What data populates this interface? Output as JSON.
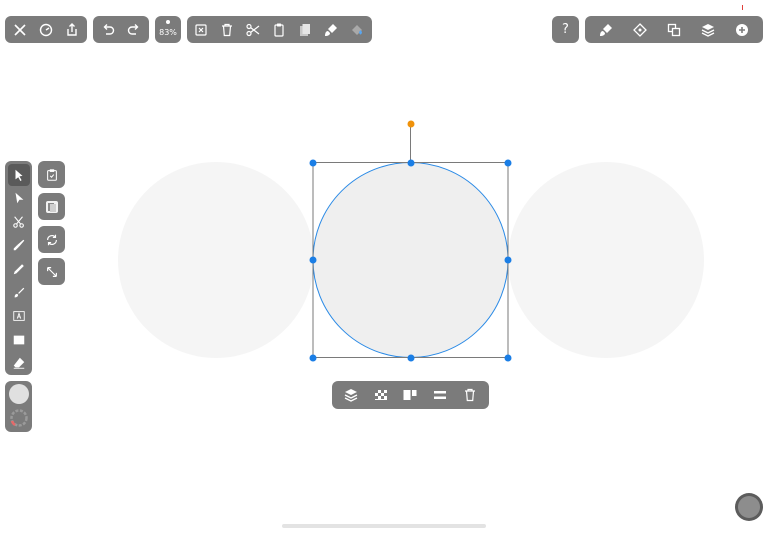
{
  "top_left": {
    "buttons": [
      {
        "name": "close-button",
        "icon": "close-icon"
      },
      {
        "name": "gallery-button",
        "icon": "gallery-icon"
      },
      {
        "name": "share-button",
        "icon": "share-icon"
      }
    ]
  },
  "history": {
    "buttons": [
      {
        "name": "undo-button",
        "icon": "undo-icon"
      },
      {
        "name": "redo-button",
        "icon": "redo-icon"
      }
    ]
  },
  "zoom": {
    "label": "83%"
  },
  "edit_tools": {
    "buttons": [
      {
        "name": "deselect-button",
        "icon": "deselect-icon"
      },
      {
        "name": "delete-button",
        "icon": "trash-icon"
      },
      {
        "name": "cut-button",
        "icon": "scissors-icon"
      },
      {
        "name": "copy-button",
        "icon": "copy-icon"
      },
      {
        "name": "paste-button",
        "icon": "paste-icon"
      },
      {
        "name": "copy-style-button",
        "icon": "brush-style-icon"
      },
      {
        "name": "fill-button",
        "icon": "fill-bucket-icon"
      }
    ]
  },
  "top_right": {
    "help_label": "?",
    "buttons": [
      {
        "name": "style-button",
        "icon": "brush-icon"
      },
      {
        "name": "snapping-button",
        "icon": "snap-icon"
      },
      {
        "name": "arrange-button",
        "icon": "arrange-icon"
      },
      {
        "name": "layers-button",
        "icon": "layers-icon"
      },
      {
        "name": "add-button",
        "icon": "plus-icon"
      }
    ]
  },
  "tools": [
    {
      "name": "selection-tool",
      "icon": "arrow-icon",
      "active": true
    },
    {
      "name": "direct-selection-tool",
      "icon": "direct-arrow-icon"
    },
    {
      "name": "scissors-tool",
      "icon": "scissors-icon"
    },
    {
      "name": "pen-tool",
      "icon": "pen-icon"
    },
    {
      "name": "pencil-tool",
      "icon": "pencil-icon"
    },
    {
      "name": "brush-tool",
      "icon": "brush-icon"
    },
    {
      "name": "text-tool",
      "icon": "text-icon"
    },
    {
      "name": "shape-tool",
      "icon": "rectangle-icon"
    },
    {
      "name": "eraser-tool",
      "icon": "eraser-icon"
    }
  ],
  "color_wells": [
    {
      "name": "fill-color",
      "color": "#e0e0e0"
    },
    {
      "name": "stroke-color",
      "color": "#8a8a8a"
    }
  ],
  "side_actions": [
    {
      "name": "paste-in-place-button",
      "icon": "paste-icon"
    },
    {
      "name": "duplicate-button",
      "icon": "duplicate-icon"
    },
    {
      "name": "rotate-button",
      "icon": "rotate-icon"
    },
    {
      "name": "scale-button",
      "icon": "expand-icon"
    }
  ],
  "context_menu": [
    {
      "name": "context-layers-button",
      "icon": "layers-icon"
    },
    {
      "name": "context-transparency-button",
      "icon": "checker-icon"
    },
    {
      "name": "context-align-button",
      "icon": "align-icon"
    },
    {
      "name": "context-distribute-button",
      "icon": "distribute-icon"
    },
    {
      "name": "context-delete-button",
      "icon": "trash-icon"
    }
  ],
  "colors": {
    "toolbar": "#7b7b7b",
    "selection": "#1a7ee6",
    "rotate_handle": "#f0920a",
    "shape_fill": "#efefef",
    "ghost_shape": "#f5f5f5"
  }
}
